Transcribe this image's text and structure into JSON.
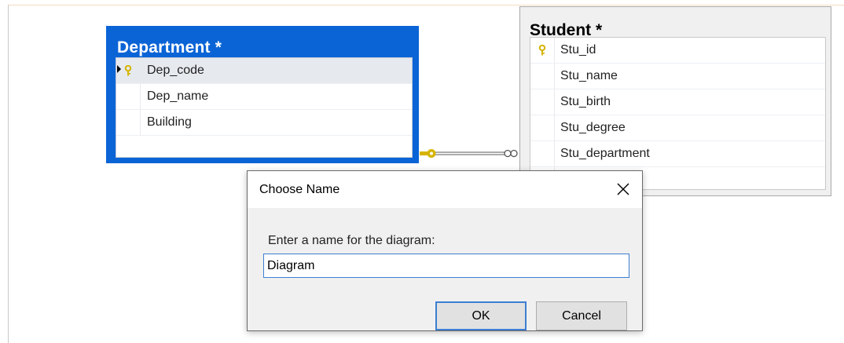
{
  "department": {
    "title": "Department *",
    "columns": [
      {
        "name": "Dep_code",
        "key": true,
        "current": true
      },
      {
        "name": "Dep_name",
        "key": false
      },
      {
        "name": "Building",
        "key": false
      }
    ]
  },
  "student": {
    "title": "Student *",
    "columns": [
      {
        "name": "Stu_id",
        "key": true
      },
      {
        "name": "Stu_name",
        "key": false
      },
      {
        "name": "Stu_birth",
        "key": false
      },
      {
        "name": "Stu_degree",
        "key": false
      },
      {
        "name": "Stu_department",
        "key": false
      }
    ]
  },
  "dialog": {
    "title": "Choose Name",
    "prompt": "Enter a name for the diagram:",
    "value": "Diagram",
    "ok_label": "OK",
    "cancel_label": "Cancel"
  },
  "colors": {
    "selected_table": "#0a64d6",
    "key_icon": "#d5b400",
    "focus_border": "#3c7fd2"
  },
  "icons": {
    "key": "key-icon",
    "row_selector": "row-selector-arrow-icon",
    "close": "close-icon",
    "relationship": "relationship-line"
  }
}
